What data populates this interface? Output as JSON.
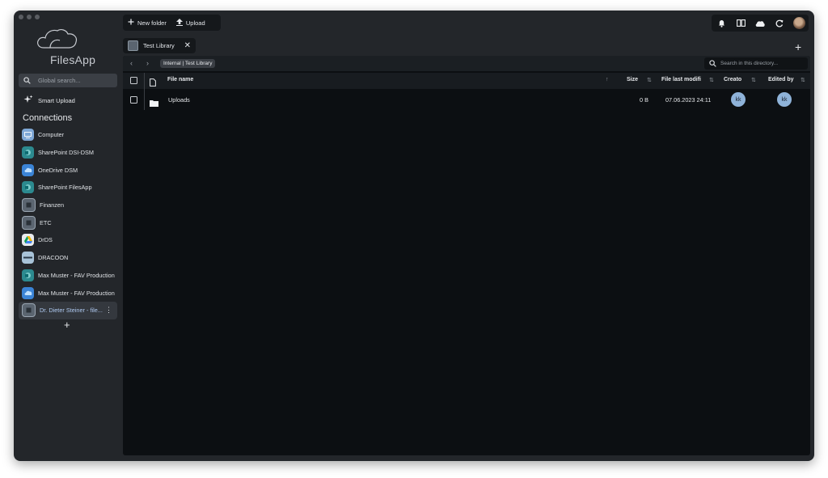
{
  "app": {
    "name": "FilesApp"
  },
  "sidebar": {
    "search_placeholder": "Global search...",
    "smart_upload": "Smart Upload",
    "connections_title": "Connections",
    "connections": [
      {
        "label": "Computer",
        "icon": "computer-icon",
        "color": "#7fa8d6"
      },
      {
        "label": "SharePoint DSI-DSM",
        "icon": "sharepoint-icon",
        "color": "#2c8a8f"
      },
      {
        "label": "OneDrive DSM",
        "icon": "onedrive-icon",
        "color": "#3b84d6"
      },
      {
        "label": "SharePoint FilesApp",
        "icon": "sharepoint-icon",
        "color": "#2c8a8f"
      },
      {
        "label": "Finanzen",
        "icon": "server-icon",
        "color": "#5b6570"
      },
      {
        "label": "ETC",
        "icon": "server-icon",
        "color": "#5b6570"
      },
      {
        "label": "DrDS",
        "icon": "google-drive-icon",
        "color": "#f4b400"
      },
      {
        "label": "DRACOON",
        "icon": "dracoon-icon",
        "color": "#a8c3d8"
      },
      {
        "label": "Max Muster - FAV Production",
        "icon": "sharepoint-icon",
        "color": "#2c8a8f"
      },
      {
        "label": "Max Muster - FAV Production",
        "icon": "onedrive-icon",
        "color": "#3b84d6"
      },
      {
        "label": "Dr. Dieter Steiner - file...",
        "icon": "server-icon",
        "color": "#5b6570",
        "active": true
      }
    ],
    "add_label": "+"
  },
  "toolbar": {
    "new_folder": "New folder",
    "upload": "Upload"
  },
  "tabs": [
    {
      "label": "Test Library",
      "close": "✕"
    }
  ],
  "new_tab": "+",
  "breadcrumb": "Internal | Test Library",
  "dir_search_placeholder": "Search in this directory...",
  "columns": {
    "name": "File name",
    "size": "Size",
    "modified": "File last modifi",
    "created": "Creato",
    "edited": "Edited by"
  },
  "rows": [
    {
      "name": "Uploads",
      "size": "0 B",
      "modified": "07.06.2023 24:11",
      "creator": "kk",
      "editor": "kk"
    }
  ]
}
